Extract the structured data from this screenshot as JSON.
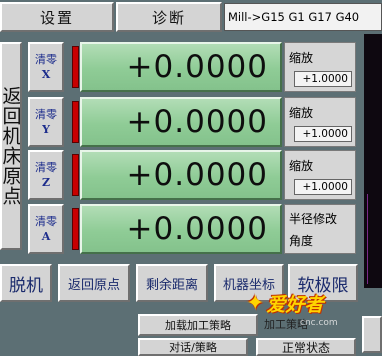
{
  "tabs": {
    "settings": "设置",
    "diagnose": "诊断"
  },
  "gcode_status": "Mill->G15  G1 G17 G40",
  "home_button": "返回机床原点",
  "axes": [
    {
      "clear_label": "清零",
      "axis": "X",
      "value": "+0.0000",
      "scale_label": "缩放",
      "scale_value": "+1.0000"
    },
    {
      "clear_label": "清零",
      "axis": "Y",
      "value": "+0.0000",
      "scale_label": "缩放",
      "scale_value": "+1.0000"
    },
    {
      "clear_label": "清零",
      "axis": "Z",
      "value": "+0.0000",
      "scale_label": "缩放",
      "scale_value": "+1.0000"
    },
    {
      "clear_label": "清零",
      "axis": "A",
      "value": "+0.0000",
      "radius_line1": "半径修改",
      "radius_line2": "角度"
    }
  ],
  "buttons": {
    "offline": "脱机",
    "go_home": "返回原点",
    "dist_to_go": "剩余距离",
    "machine_coords": "机器坐标",
    "soft_limits": "软极限"
  },
  "bottom": {
    "load_strategy": "加载加工策略",
    "dialog_strategy": "对话/策略",
    "status_partial": "正常状态",
    "overlay_text": "加工策略"
  },
  "watermark": {
    "logo": "爱好者",
    "site": "cnc.com"
  },
  "colors": {
    "dro_green": "#8fcc96",
    "axis_red": "#c80000",
    "button_blue_text": "#1d2d8c"
  }
}
